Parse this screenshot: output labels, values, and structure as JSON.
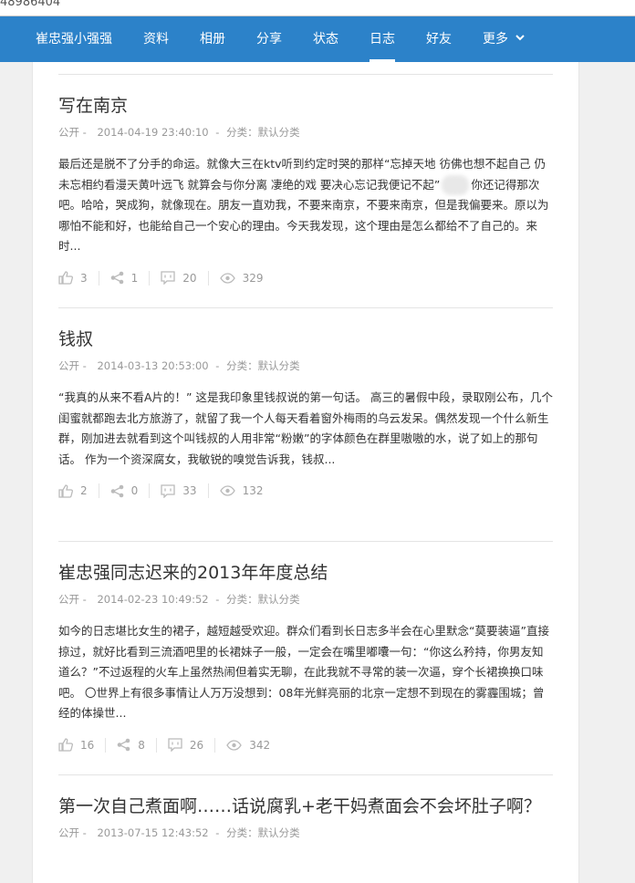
{
  "address": "48986404",
  "nav": {
    "home": "崔忠强小强强",
    "items": [
      "资料",
      "相册",
      "分享",
      "状态",
      "日志",
      "好友"
    ],
    "more": "更多"
  },
  "posts": [
    {
      "title": "写在南京",
      "visibility": "公开 -",
      "date": "2014-04-19 23:40:10",
      "category_label": "分类：",
      "category": "默认分类",
      "excerpt_a": "最后还是脱不了分手的命运。就像大三在ktv听到约定时哭的那样“忘掉天地 彷佛也想不起自己 仍未忘相约看漫天黄叶远飞 就算会与你分离 凄绝的戏 要决心忘记我便记不起”",
      "excerpt_b": "你还记得那次吧。哈哈，哭成狗，就像现在。朋友一直劝我，不要来南京，不要来南京，但是我偏要来。原以为哪怕不能和好，也能给自己一个安心的理由。今天我发现，这个理由是怎么都给不了自己的。来时...",
      "likes": "3",
      "shares": "1",
      "comments": "20",
      "views": "329"
    },
    {
      "title": "钱叔",
      "visibility": "公开 -",
      "date": "2014-03-13 20:53:00",
      "category_label": "分类：",
      "category": "默认分类",
      "excerpt": "“我真的从来不看A片的！” 这是我印象里钱叔说的第一句话。 高三的暑假中段，录取刚公布，几个闺蜜就都跑去北方旅游了，就留了我一个人每天看着窗外梅雨的乌云发呆。偶然发现一个什么新生群，刚加进去就看到这个叫钱叔的人用非常“粉嫩”的字体颜色在群里嗷嗷的水，说了如上的那句话。 作为一个资深腐女，我敏锐的嗅觉告诉我，钱叔...",
      "likes": "2",
      "shares": "0",
      "comments": "33",
      "views": "132"
    },
    {
      "title": "崔忠强同志迟来的2013年年度总结",
      "visibility": "公开 -",
      "date": "2014-02-23 10:49:52",
      "category_label": "分类：",
      "category": "默认分类",
      "excerpt": "如今的日志堪比女生的裙子，越短越受欢迎。群众们看到长日志多半会在心里默念“莫要装逼”直接掠过，就好比看到三流酒吧里的长裙妹子一般，一定会在嘴里嘟囔一句：“你这么矜持，你男友知道么？”不过返程的火车上虽然热闹但着实无聊，在此我就不寻常的装一次逼，穿个长裙换换口味吧。 〇世界上有很多事情让人万万没想到：08年光鲜亮丽的北京一定想不到现在的雾霾围城；曾经的体操世...",
      "likes": "16",
      "shares": "8",
      "comments": "26",
      "views": "342"
    },
    {
      "title": "第一次自己煮面啊……话说腐乳+老干妈煮面会不会坏肚子啊？",
      "visibility": "公开 -",
      "date": "2013-07-15 12:43:52",
      "category_label": "分类：",
      "category": "默认分类"
    }
  ],
  "colors": {
    "nav": "#2c82c9",
    "meta": "#999999",
    "icon": "#bbbbbb"
  },
  "icons": {
    "like": "thumbs-up-icon",
    "share": "share-icon",
    "comment": "comment-icon",
    "view": "eye-icon",
    "more": "chevron-down-icon"
  }
}
